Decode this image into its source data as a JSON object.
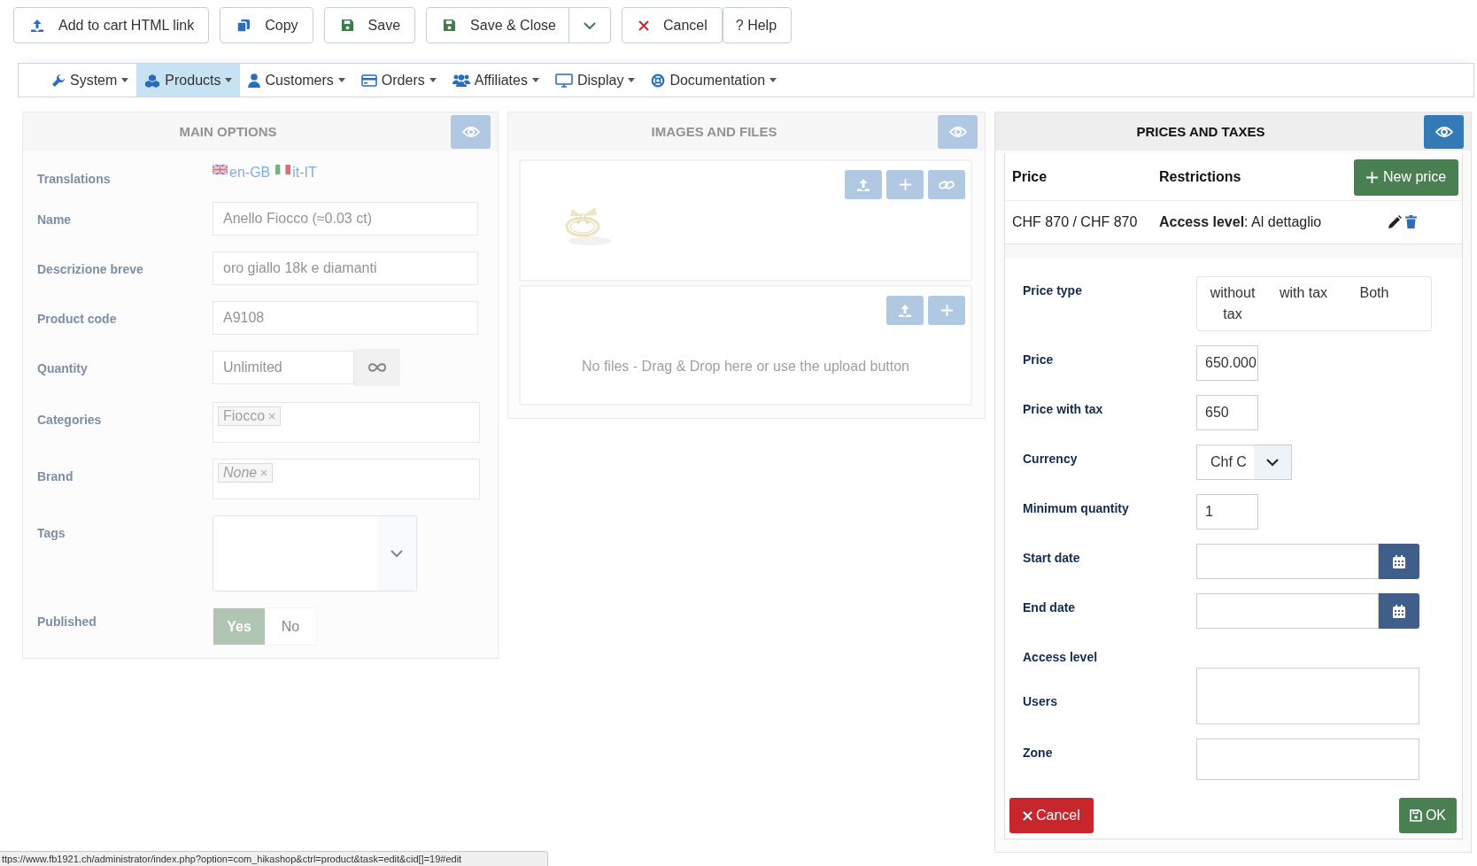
{
  "toolbar": [
    {
      "label": "Add to cart HTML link",
      "kind": "upload"
    },
    {
      "label": "Copy",
      "kind": "copy"
    },
    {
      "label": "Save",
      "kind": "save"
    },
    {
      "label": "Save & Close",
      "kind": "save-split"
    },
    {
      "label": "Cancel",
      "kind": "cancel"
    },
    {
      "label": "? Help",
      "kind": "plain"
    }
  ],
  "menu": [
    {
      "label": "System",
      "kind": "wrench",
      "selected": false
    },
    {
      "label": "Products",
      "kind": "cubes",
      "selected": true
    },
    {
      "label": "Customers",
      "kind": "user",
      "selected": false
    },
    {
      "label": "Orders",
      "kind": "card",
      "selected": false
    },
    {
      "label": "Affiliates",
      "kind": "users",
      "selected": false
    },
    {
      "label": "Display",
      "kind": "monitor",
      "selected": false
    },
    {
      "label": "Documentation",
      "kind": "lifebuoy",
      "selected": false
    }
  ],
  "main_options": {
    "title": "MAIN OPTIONS",
    "dimmed": true,
    "translations_label": "Translations",
    "translations": [
      {
        "label": "en-GB",
        "kind": "gb"
      },
      {
        "label": "it-IT",
        "kind": "it"
      }
    ],
    "fields": [
      {
        "kind": "text",
        "label": "Name",
        "value": "Anello Fiocco (≈0.03 ct)"
      },
      {
        "kind": "text",
        "label": "Descrizione breve",
        "value": "oro giallo 18k e diamanti"
      },
      {
        "kind": "text",
        "label": "Product code",
        "value": "A9108"
      },
      {
        "kind": "quantity",
        "label": "Quantity",
        "value": "Unlimited"
      },
      {
        "kind": "tags",
        "label": "Categories",
        "tags": [
          {
            "text": "Fiocco",
            "italic": false
          }
        ]
      },
      {
        "kind": "tags",
        "label": "Brand",
        "tags": [
          {
            "text": "None",
            "italic": true
          }
        ]
      },
      {
        "kind": "select",
        "label": "Tags"
      },
      {
        "kind": "toggle",
        "label": "Published",
        "options": [
          {
            "label": "Yes",
            "selected": true
          },
          {
            "label": "No",
            "selected": false
          }
        ]
      }
    ]
  },
  "images_and_files": {
    "title": "IMAGES AND FILES",
    "dimmed": true,
    "files_message": "No files - Drag & Drop here or use the upload button"
  },
  "prices_and_taxes": {
    "title": "PRICES AND TAXES",
    "dimmed": false,
    "columns": [
      "Price",
      "Restrictions"
    ],
    "new_price_button": "New price",
    "rows": [
      {
        "price": "CHF 870 / CHF 870",
        "restrictions": "**Access level**: Al dettaglio"
      }
    ],
    "form": [
      {
        "kind": "choice",
        "label": "Price type",
        "options": [
          "without tax",
          "with tax",
          "Both"
        ]
      },
      {
        "kind": "short",
        "label": "Price",
        "value": "650.000"
      },
      {
        "kind": "short",
        "label": "Price with tax",
        "value": "650"
      },
      {
        "kind": "select",
        "label": "Currency",
        "value": "Chf C"
      },
      {
        "kind": "short",
        "label": "Minimum quantity",
        "value": "1"
      },
      {
        "kind": "date",
        "label": "Start date"
      },
      {
        "kind": "date",
        "label": "End date"
      },
      {
        "kind": "heading",
        "label": "Access level"
      },
      {
        "kind": "area",
        "label": "Users"
      },
      {
        "kind": "box",
        "label": "Zone"
      }
    ],
    "cancel_button": "Cancel",
    "ok_button": "OK"
  },
  "status_bar": "ttps://www.fb1921.ch/administrator/index.php?option=com_hikashop&ctrl=product&task=edit&cid[]=19#edit"
}
